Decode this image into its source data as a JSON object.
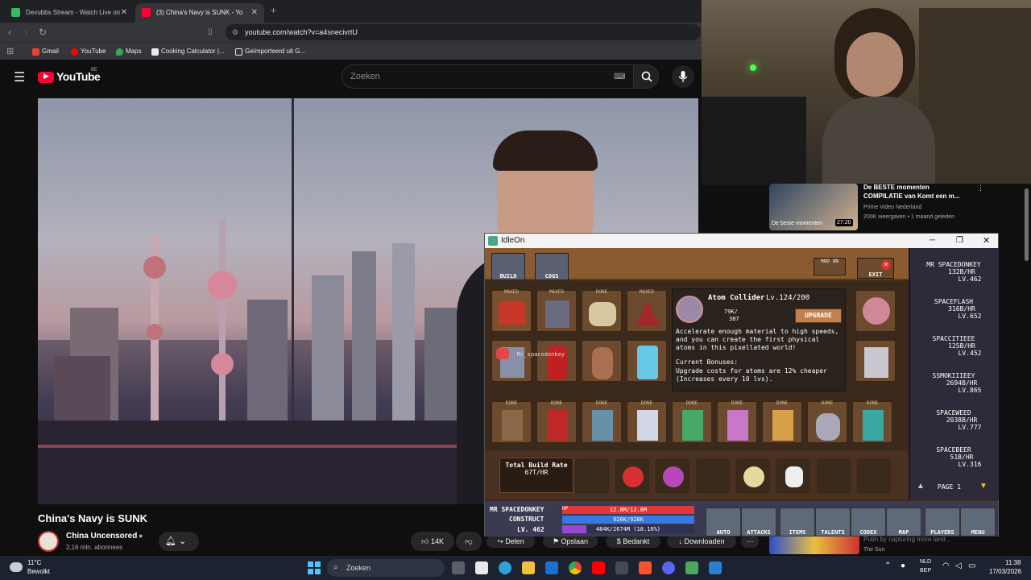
{
  "browser": {
    "tabs": [
      {
        "label": "Devubbs Stream - Watch Live on",
        "active": false
      },
      {
        "label": "(3) China's Navy is SUNK - Yo",
        "active": true
      }
    ],
    "url": "youtube.com/watch?v=a4snecivrtU",
    "bookmarks": [
      "Gmail",
      "YouTube",
      "Maps",
      "Cooking Calculator |...",
      "Geïmporteerd uit G..."
    ]
  },
  "youtube": {
    "logo": "YouTube",
    "country": "BE",
    "search_placeholder": "Zoeken",
    "video_title": "China's Navy is SUNK",
    "channel_name": "China Uncensored",
    "subscribers": "2,16 mln. abonnees",
    "likes": "14K",
    "actions": [
      "Delen",
      "Opslaan",
      "Bedankt",
      "Downloaden"
    ],
    "suggestion": {
      "title_line1": "De BESTE momenten",
      "title_line2": "COMPILATIE van Komt een m...",
      "channel": "Prime Video Nederland",
      "meta": "200K weergaven • 1 maand geleden",
      "duration": "27:20",
      "thumb_text": "De beste momenten"
    },
    "suggestion2": {
      "line1": "Putin by capturing more land...",
      "channel": "The Sun"
    }
  },
  "game": {
    "window_title": "IdleOn",
    "top_buttons": [
      "BUILD",
      "COGS"
    ],
    "hud_label": "HUD ON",
    "exit_label": "EXIT",
    "tooltip": {
      "name": "Atom Collider",
      "level": "Lv.124/200",
      "cost_top": "79K/",
      "cost_bottom": "387",
      "upgrade_label": "UPGRADE",
      "description": "Accelerate enough material to high speeds, and you can create the first physical atoms in this pixellated world!",
      "bonus_header": "Current Bonuses:",
      "bonus_text": "Upgrade costs for atoms are 12% cheaper (Increases every 10 lvs)."
    },
    "chat_user": "Mr_spacedonkey",
    "build_rate_label": "Total Build Rate",
    "build_rate_value": "67T/HR",
    "players": [
      {
        "name": "MR SPACEDONKEY",
        "rate": "132B/HR",
        "level": "LV.462"
      },
      {
        "name": "SPACEFLASH",
        "rate": "316B/HR",
        "level": "LV.652"
      },
      {
        "name": "SPACCITIEEE",
        "rate": "125B/HR",
        "level": "LV.452"
      },
      {
        "name": "SSMOKIIIEEY",
        "rate": "2694B/HR",
        "level": "LV.865"
      },
      {
        "name": "SPACEWEED",
        "rate": "2038B/HR",
        "level": "LV.777"
      },
      {
        "name": "SPACEBEER",
        "rate": "51B/HR",
        "level": "LV.316"
      }
    ],
    "page_label": "PAGE 1",
    "status": {
      "name": "MR SPACEDONKEY",
      "job": "CONSTRUCT",
      "level": "LV. 462",
      "hp": "12.8M/12.8M",
      "mp": "926K/926K",
      "xp": "484K/2674M (18.16%)"
    },
    "bottom_buttons": [
      "AUTO",
      "ATTACKS",
      "ITEMS",
      "TALENTS",
      "CODEX",
      "MAP",
      "PLAYERS",
      "MENU"
    ],
    "slot_labels": [
      "MAXED",
      "MAXED",
      "DONE",
      "MAXED",
      "DONE",
      "DONE",
      "DONE",
      "DONE",
      "DONE",
      "DONE",
      "DONE",
      "DONE",
      "DONE",
      "DONE"
    ]
  },
  "taskbar": {
    "weather_temp": "11°C",
    "weather_desc": "Bewolkt",
    "search": "Zoeken",
    "lang_top": "NLD",
    "lang_bottom": "BEP",
    "time": "11:38",
    "date": "17/03/2026"
  }
}
